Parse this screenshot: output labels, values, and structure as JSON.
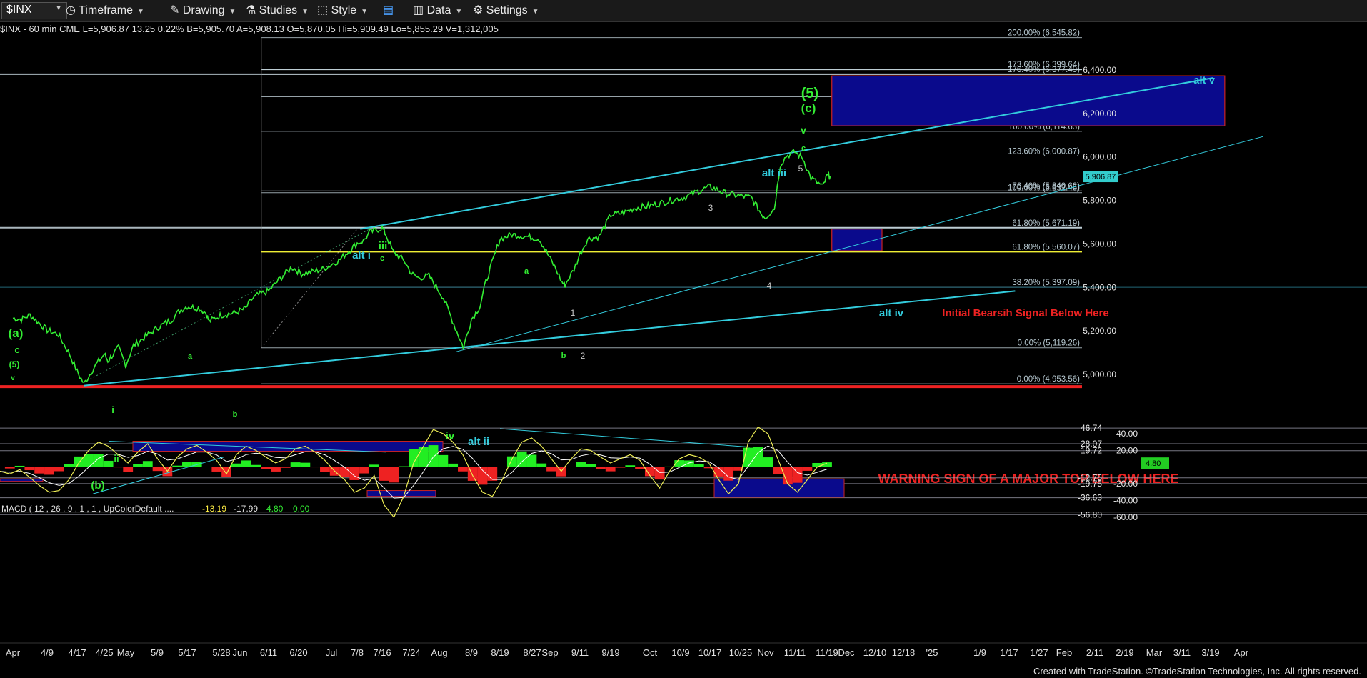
{
  "toolbar": {
    "symbol": "$INX",
    "timeframe": "Timeframe",
    "drawing": "Drawing",
    "studies": "Studies",
    "style": "Style",
    "data": "Data",
    "settings": "Settings"
  },
  "status_line": "$INX - 60 min  CME  L=5,906.87  13.25  0.22%  B=5,905.70  A=5,908.13  O=5,870.05  Hi=5,909.49  Lo=5,855.29  V=1,312,005",
  "colors": {
    "background": "#000000",
    "price": "#33ee33",
    "trendline": "#33ccdd",
    "fib": "#c8d8e0",
    "support": "#eeee33",
    "warning": "#ee2222",
    "box_fill": "#0a0a8c",
    "box_border": "#cc2222"
  },
  "chart_data": [
    {
      "type": "line",
      "title": "",
      "symbol": "$INX",
      "interval": "60 min",
      "ylim": [
        4880,
        6580
      ],
      "y_ticks": [
        5000,
        5200,
        5400,
        5600,
        5800,
        6000,
        6200,
        6400
      ],
      "y_tick_labels": [
        "5,000.00",
        "5,200.00",
        "5,400.00",
        "5,600.00",
        "5,800.00",
        "6,000.00",
        "6,200.00",
        "6,400.00"
      ],
      "x_tick_labels": [
        "Apr",
        "4/9",
        "4/17",
        "4/25",
        "May",
        "5/9",
        "5/17",
        "5/28",
        "Jun",
        "6/11",
        "6/20",
        "Jul",
        "7/8",
        "7/16",
        "7/24",
        "Aug",
        "8/9",
        "8/19",
        "8/27",
        "Sep",
        "9/11",
        "9/19",
        "Oct",
        "10/9",
        "10/17",
        "10/25",
        "Nov",
        "11/11",
        "11/19",
        "Dec",
        "12/10",
        "12/18",
        "'25",
        "1/9",
        "1/17",
        "1/27",
        "Feb",
        "2/11",
        "2/19",
        "Mar",
        "3/11",
        "3/19",
        "Apr"
      ],
      "last_price": "5,906.87",
      "series": [
        {
          "name": "$INX",
          "x": [
            "4/1",
            "4/3",
            "4/5",
            "4/9",
            "4/12",
            "4/15",
            "4/17",
            "4/19",
            "4/22",
            "4/25",
            "4/26",
            "4/29",
            "5/1",
            "5/3",
            "5/6",
            "5/9",
            "5/13",
            "5/15",
            "5/17",
            "5/21",
            "5/23",
            "5/24",
            "5/28",
            "5/31",
            "6/3",
            "6/5",
            "6/7",
            "6/11",
            "6/14",
            "6/18",
            "6/21",
            "6/25",
            "6/28",
            "7/3",
            "7/8",
            "7/10",
            "7/12",
            "7/16",
            "7/17",
            "7/19",
            "7/22",
            "7/24",
            "7/26",
            "7/29",
            "8/2",
            "8/5",
            "8/7",
            "8/9",
            "8/12",
            "8/14",
            "8/16",
            "8/19",
            "8/22",
            "8/26",
            "8/29",
            "9/3",
            "9/5",
            "9/6",
            "9/9",
            "9/11",
            "9/13",
            "9/16",
            "9/19",
            "9/23",
            "9/26",
            "9/30",
            "10/3",
            "10/7",
            "10/10",
            "10/14",
            "10/17",
            "10/21",
            "10/24",
            "10/28",
            "10/31",
            "11/1",
            "11/4",
            "11/6",
            "11/8",
            "11/11",
            "11/13",
            "11/15",
            "11/18",
            "11/19",
            "11/21"
          ],
          "values": [
            5255,
            5250,
            5270,
            5200,
            5180,
            5090,
            5010,
            4953,
            5030,
            5090,
            5060,
            5120,
            5040,
            5130,
            5170,
            5210,
            5250,
            5290,
            5310,
            5300,
            5280,
            5240,
            5270,
            5280,
            5300,
            5340,
            5360,
            5380,
            5430,
            5490,
            5460,
            5470,
            5480,
            5520,
            5600,
            5610,
            5650,
            5670,
            5640,
            5560,
            5520,
            5460,
            5440,
            5450,
            5350,
            5210,
            5120,
            5250,
            5310,
            5420,
            5500,
            5620,
            5640,
            5630,
            5620,
            5480,
            5420,
            5408,
            5480,
            5550,
            5620,
            5630,
            5730,
            5740,
            5760,
            5770,
            5780,
            5800,
            5810,
            5840,
            5860,
            5830,
            5820,
            5810,
            5730,
            5720,
            5760,
            5960,
            6000,
            6020,
            5990,
            5900,
            5860,
            5910,
            5906.87
          ]
        }
      ],
      "fib_levels": [
        {
          "label": "200.00% (6,545.82)",
          "value": 6545.82
        },
        {
          "label": "176.40% (6,377.49)",
          "value": 6377.49
        },
        {
          "label": "173.60% (6,399.64)",
          "value": 6399.64
        },
        {
          "label": "161.80% (6,273.35)",
          "value": 6273.35
        },
        {
          "label": "100.00% (6,114.63)",
          "value": 6114.63
        },
        {
          "label": "123.60% (6,000.87)",
          "value": 6000.87
        },
        {
          "label": "76.40% (5,840.62)",
          "value": 5840.62
        },
        {
          "label": "100.00% (5,832.45)",
          "value": 5832.45
        },
        {
          "label": "61.80% (5,671.19)",
          "value": 5671.19
        },
        {
          "label": "61.80% (5,560.07)",
          "value": 5560.07
        },
        {
          "label": "38.20% (5,397.09)",
          "value": 5397.09
        },
        {
          "label": "0.00% (5,119.26)",
          "value": 5119.26
        },
        {
          "label": "0.00% (4,953.56)",
          "value": 4953.56
        }
      ],
      "support_line": 5560.07,
      "warning_line": 4953.56,
      "target_boxes": [
        {
          "x_start": "11/22",
          "x_end": "3/25",
          "y_low": 6140,
          "y_high": 6370
        },
        {
          "x_start": "11/22",
          "x_end": "12/12",
          "y_low": 5565,
          "y_high": 5665
        }
      ],
      "trendlines": [
        {
          "x": [
            "7/9",
            "3/20"
          ],
          "y": [
            5665,
            6360
          ]
        },
        {
          "x": [
            "8/5",
            "4/7"
          ],
          "y": [
            5100,
            6090
          ]
        },
        {
          "x": [
            "4/19",
            "1/19"
          ],
          "y": [
            4945,
            5380
          ]
        }
      ],
      "annotations": {
        "wave_labels_green": [
          "(a)",
          "c",
          "(5)",
          "v",
          "i",
          "ii",
          "a",
          "b",
          "(b)",
          "iii",
          "c",
          "iv",
          "a",
          "b",
          "(5)",
          "(c)",
          "v",
          "c"
        ],
        "wave_labels_gray": [
          "1",
          "2",
          "3",
          "4",
          "5"
        ],
        "alt_labels": [
          "alt i",
          "alt ii",
          "alt iii",
          "alt iv",
          "alt v"
        ],
        "signal_text": "Initial Bearsih Signal Below Here",
        "warning_text": "WARNING SIGN OF A MAJOR TOP BELOW HERE"
      }
    },
    {
      "type": "line",
      "title": "MACD ( 12 , 26 , 9 , 1 , 1 , UpColorDefault ....",
      "readings": [
        "-13.19",
        "-17.99",
        "4.80",
        "0.00"
      ],
      "ylim": [
        -65,
        50
      ],
      "y_ticks": [
        40,
        20,
        -20,
        -40,
        -60
      ],
      "y_tick_labels": [
        "40.00",
        "20.00",
        "-20.00",
        "-40.00",
        "-60.00"
      ],
      "level_labels": [
        "46.74",
        "28.07",
        "19.72",
        "-12.75",
        "-19.75",
        "-36.63",
        "-56.80"
      ],
      "current_value_label": "4.80",
      "series": [
        {
          "name": "MACD",
          "values": [
            -5,
            -8,
            -3,
            -12,
            -22,
            -30,
            -28,
            -15,
            5,
            20,
            30,
            25,
            15,
            5,
            18,
            28,
            10,
            -5,
            12,
            22,
            26,
            18,
            8,
            -8,
            15,
            25,
            20,
            12,
            5,
            10,
            22,
            25,
            18,
            8,
            -5,
            -15,
            -30,
            -25,
            -10,
            -45,
            -60,
            -35,
            5,
            25,
            45,
            40,
            30,
            15,
            -10,
            -30,
            -35,
            -15,
            10,
            30,
            35,
            25,
            10,
            -5,
            10,
            22,
            20,
            12,
            5,
            10,
            15,
            8,
            -10,
            -25,
            -5,
            10,
            15,
            12,
            5,
            -15,
            -32,
            -20,
            30,
            48,
            40,
            10,
            -20,
            -30,
            -15,
            0,
            4.8
          ]
        }
      ]
    }
  ],
  "footer": "Created with TradeStation. ©TradeStation Technologies, Inc. All rights reserved."
}
